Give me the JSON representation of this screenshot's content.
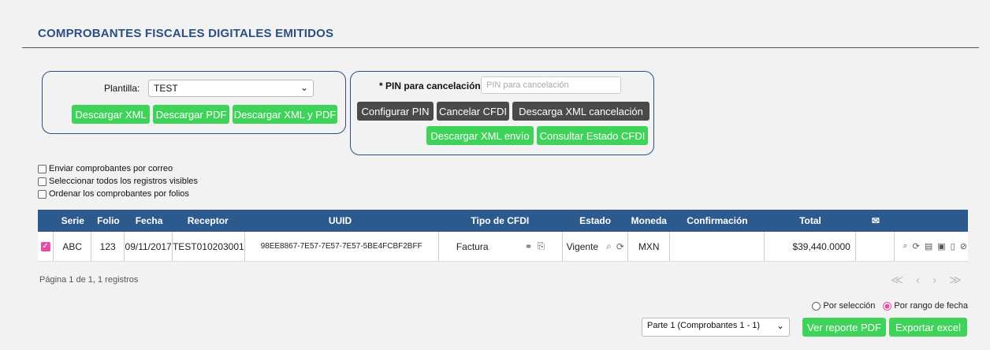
{
  "page": {
    "title": "COMPROBANTES FISCALES DIGITALES EMITIDOS"
  },
  "left_panel": {
    "plantilla_label": "Plantilla:",
    "plantilla_value": "TEST",
    "buttons": [
      "Descargar XML",
      "Descargar PDF",
      "Descargar XML y PDF"
    ]
  },
  "right_panel": {
    "pin_label": "* PIN para cancelación:",
    "pin_placeholder": "PIN para cancelación",
    "buttons_row1": [
      "Configurar PIN",
      "Cancelar CFDI",
      "Descarga XML cancelación"
    ],
    "buttons_row2": [
      "Descargar XML envío",
      "Consultar Estado CFDI"
    ]
  },
  "options": [
    "Enviar comprobantes por correo",
    "Seleccionar todos los registros visibles",
    "Ordenar los comprobantes por folios"
  ],
  "table": {
    "headers": [
      "",
      "Serie",
      "Folio",
      "Fecha",
      "Receptor",
      "UUID",
      "Tipo de CFDI",
      "Estado",
      "Moneda",
      "Confirmación",
      "Total",
      "",
      ""
    ],
    "row": {
      "serie": "ABC",
      "folio": "123",
      "fecha": "09/11/2017",
      "receptor": "TEST010203001",
      "uuid": "98EE8867-7E57-7E57-7E57-5BE4FCBF2BFF",
      "tipo": "Factura",
      "estado": "Vigente",
      "moneda": "MXN",
      "confirmacion": "",
      "total": "$39,440.0000"
    },
    "header_icon": "email-check-icon"
  },
  "pager": {
    "text": "Página 1 de 1, 1 registros",
    "nav": "≪ ‹ › ≫"
  },
  "report": {
    "radio1": "Por selección",
    "radio2": "Por rango de fecha",
    "parte_value": "Parte 1 (Comprobantes 1 - 1)",
    "btn_pdf": "Ver reporte PDF",
    "btn_excel": "Exportar excel"
  },
  "colors": {
    "accent": "#2a4f86",
    "header_bg": "#2d5a8c",
    "green": "#3fd35a",
    "dark": "#4a4a4a",
    "pink": "#e44da8"
  }
}
